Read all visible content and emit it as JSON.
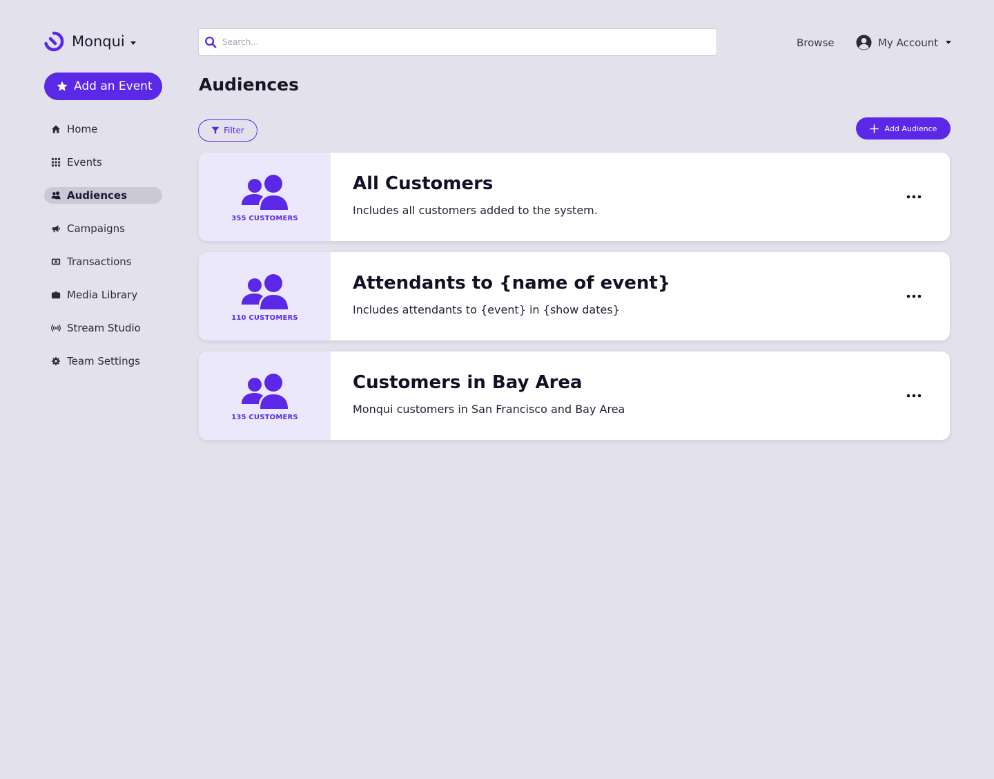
{
  "brand": {
    "name": "Monqui"
  },
  "sidebar": {
    "add_event_label": "Add an Event",
    "items": [
      {
        "label": "Home",
        "icon": "home-icon"
      },
      {
        "label": "Events",
        "icon": "grid-icon"
      },
      {
        "label": "Audiences",
        "icon": "users-icon",
        "active": true
      },
      {
        "label": "Campaigns",
        "icon": "megaphone-icon"
      },
      {
        "label": "Transactions",
        "icon": "money-icon"
      },
      {
        "label": "Media Library",
        "icon": "folder-icon"
      },
      {
        "label": "Stream Studio",
        "icon": "broadcast-icon"
      },
      {
        "label": "Team Settings",
        "icon": "gear-icon"
      }
    ]
  },
  "header": {
    "search_placeholder": "Search...",
    "browse_label": "Browse",
    "account_label": "My Account"
  },
  "main": {
    "title": "Audiences",
    "filter_label": "Filter",
    "add_audience_label": "Add Audience",
    "audiences": [
      {
        "title": "All Customers",
        "description": "Includes all customers added to the system.",
        "count_label": "355 CUSTOMERS"
      },
      {
        "title": "Attendants to {name of event}",
        "description": "Includes attendants to {event} in {show dates}",
        "count_label": "110 CUSTOMERS"
      },
      {
        "title": "Customers in Bay Area",
        "description": "Monqui customers in San Francisco and Bay Area",
        "count_label": "135 CUSTOMERS"
      }
    ]
  },
  "colors": {
    "accent": "#5a28e6",
    "background": "#e3e1ec",
    "card_thumb": "#ece8fc",
    "active_nav": "#cbc9d6"
  }
}
